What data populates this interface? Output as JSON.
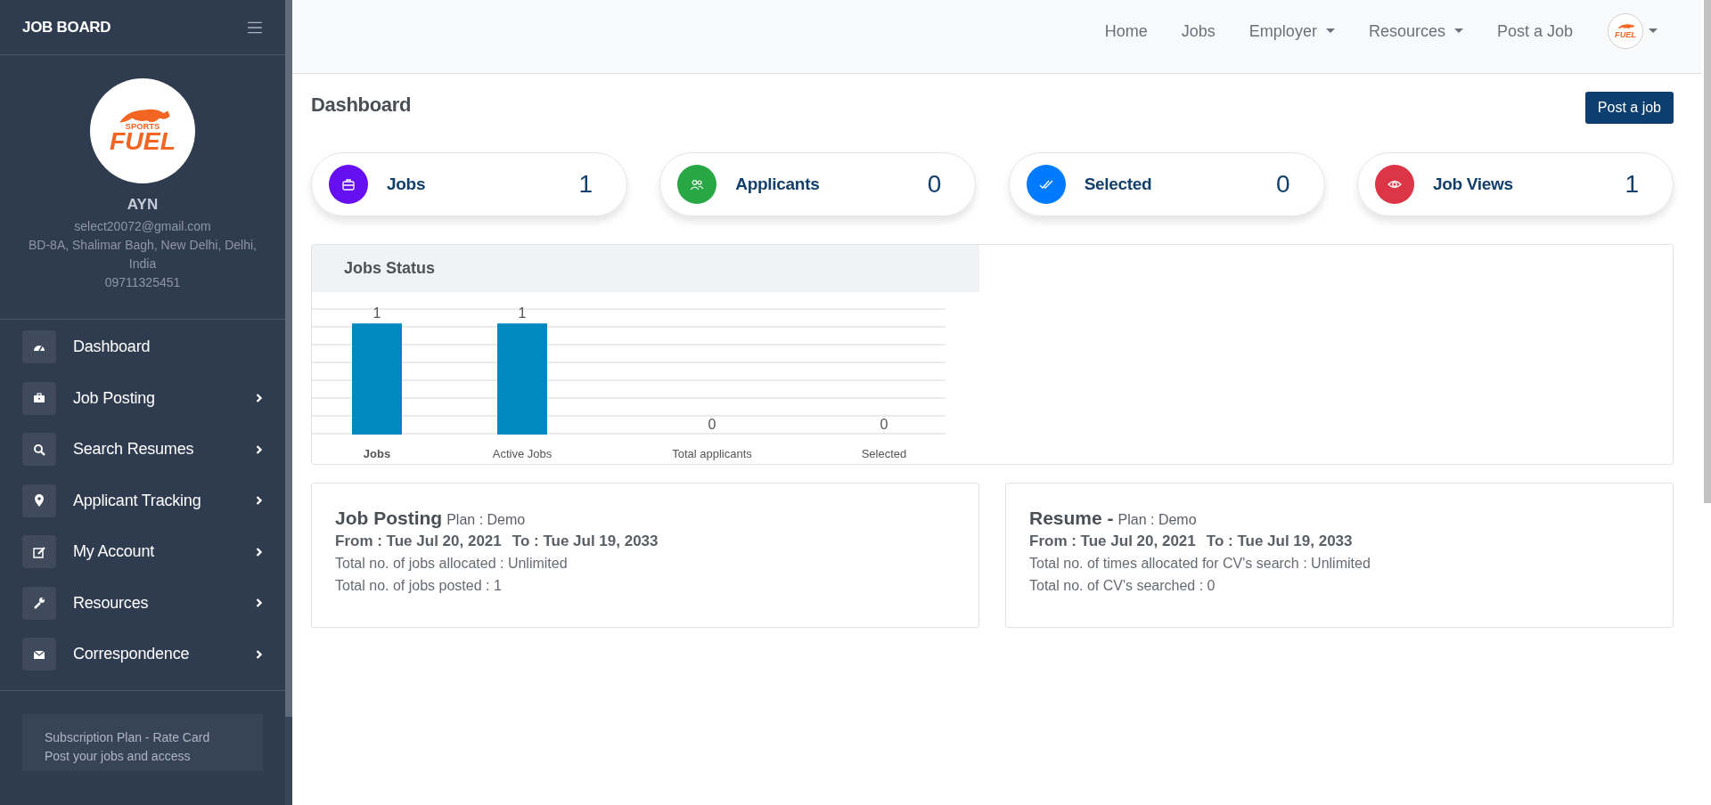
{
  "sidebar": {
    "brand": "JOB BOARD",
    "logo": {
      "tagline": "SPORTS",
      "word": "FUEL"
    },
    "profile": {
      "name": "AYN",
      "email": "select20072@gmail.com",
      "address": "BD-8A, Shalimar Bagh, New Delhi, Delhi, India",
      "phone": "09711325451"
    },
    "menu": [
      {
        "label": "Dashboard",
        "expandable": false
      },
      {
        "label": "Job Posting",
        "expandable": true
      },
      {
        "label": "Search Resumes",
        "expandable": true
      },
      {
        "label": "Applicant Tracking",
        "expandable": true
      },
      {
        "label": "My Account",
        "expandable": true
      },
      {
        "label": "Resources",
        "expandable": true
      },
      {
        "label": "Correspondence",
        "expandable": true
      }
    ],
    "promo": {
      "title": "Subscription Plan - Rate Card",
      "text": "Post your jobs and access"
    }
  },
  "navbar": {
    "links": [
      {
        "label": "Home",
        "dropdown": false
      },
      {
        "label": "Jobs",
        "dropdown": false
      },
      {
        "label": "Employer",
        "dropdown": true
      },
      {
        "label": "Resources",
        "dropdown": true
      },
      {
        "label": "Post a Job",
        "dropdown": false
      }
    ],
    "avatar": {
      "word": "FUEL"
    }
  },
  "page": {
    "title": "Dashboard",
    "action": "Post a job"
  },
  "stats": [
    {
      "label": "Jobs",
      "value": "1",
      "color": "#6610f2"
    },
    {
      "label": "Applicants",
      "value": "0",
      "color": "#28a745"
    },
    {
      "label": "Selected",
      "value": "0",
      "color": "#007bff"
    },
    {
      "label": "Job Views",
      "value": "1",
      "color": "#dc3545"
    }
  ],
  "chart": {
    "title": "Jobs Status",
    "chart_data": {
      "type": "bar",
      "categories": [
        "Jobs",
        "Active Jobs",
        "Total applicants",
        "Selected"
      ],
      "values": [
        1,
        1,
        0,
        0
      ],
      "data_labels": true
    }
  },
  "plans": [
    {
      "title": "Job Posting",
      "plan": "Plan : Demo",
      "from": "From : Tue Jul 20, 2021",
      "to": "To : Tue Jul 19, 2033",
      "lines": [
        "Total no. of jobs allocated : Unlimited",
        "Total no. of jobs posted : 1"
      ]
    },
    {
      "title": "Resume -",
      "plan": "Plan : Demo",
      "from": "From : Tue Jul 20, 2021",
      "to": "To : Tue Jul 19, 2033",
      "lines": [
        "Total no. of times allocated for CV's search : Unlimited",
        "Total no. of CV's searched : 0"
      ]
    }
  ]
}
